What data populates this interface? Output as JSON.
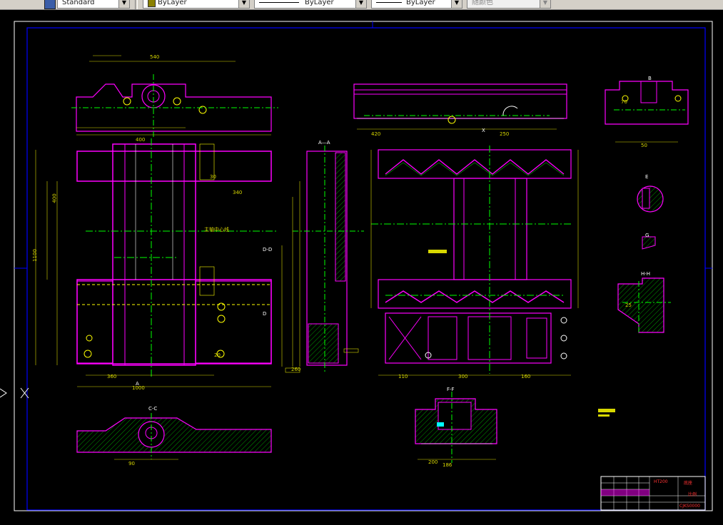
{
  "toolbar": {
    "textstyle": "Standard",
    "layer_color": "ByLayer",
    "linetype": "ByLayer",
    "lineweight": "ByLayer",
    "plotstyle": "随颜色",
    "layer_swatch_color": "#8a8000"
  },
  "drawing": {
    "colors": {
      "border": "#0000ff",
      "frame": "#ffffff",
      "part": "#ff00ff",
      "dim": "#d8d800",
      "center": "#00ff00",
      "hatch": "#00ff00"
    },
    "center_text": "主轴中心线",
    "labels": {
      "c_c": "C-C",
      "f_f": "F-F",
      "a_a": "A—A",
      "b_view": "B",
      "e_view": "E",
      "d_view": "D",
      "h_h": "H-H",
      "g_view": "G",
      "d_d": "D-D",
      "x_mark": "X",
      "a_mark": "A"
    },
    "dims": [
      "1000",
      "400",
      "1100",
      "360",
      "110",
      "300",
      "160",
      "186",
      "90",
      "420",
      "540",
      "50",
      "260",
      "25",
      "70",
      "30",
      "20",
      "200",
      "250",
      "340",
      "400"
    ],
    "title_block": {
      "material": "HT200",
      "name": "底座",
      "label2": "比例",
      "code": "CJKS0000"
    }
  }
}
